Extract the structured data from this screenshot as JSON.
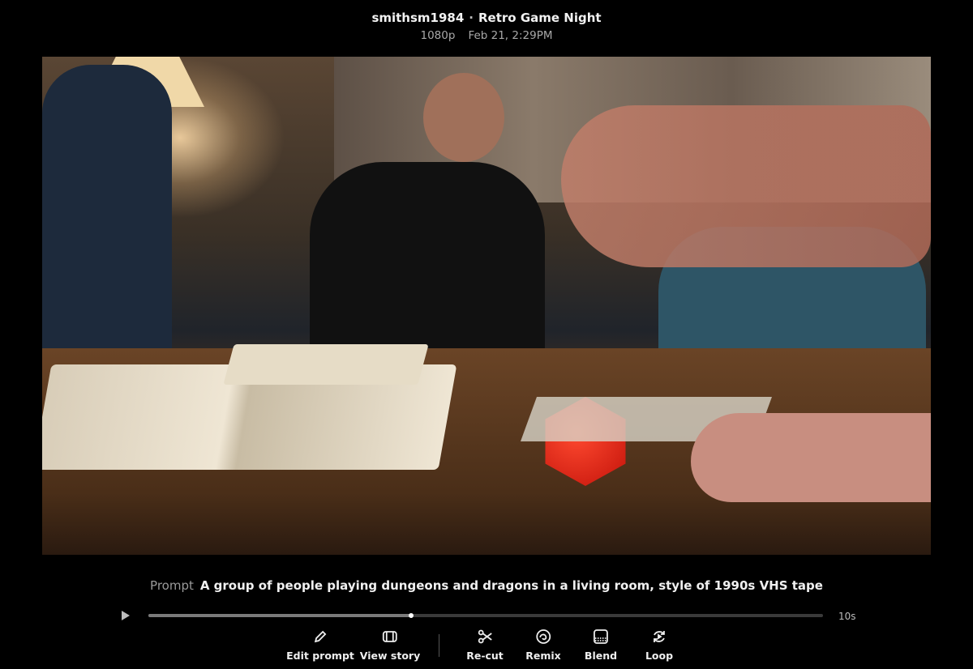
{
  "header": {
    "username": "smithsm1984",
    "separator": "·",
    "title": "Retro Game Night",
    "resolution": "1080p",
    "timestamp": "Feb 21, 2:29PM"
  },
  "video": {
    "scene": "people playing tabletop game with dice and books in a living room"
  },
  "prompt": {
    "label": "Prompt",
    "text": "A group of people playing dungeons and dragons in a living room, style of 1990s VHS tape"
  },
  "player": {
    "progress": 0.39,
    "duration": "10s",
    "play_icon": "play-icon"
  },
  "actions": [
    {
      "label": "Edit prompt",
      "icon": "pencil-icon"
    },
    {
      "label": "View story",
      "icon": "story-icon"
    },
    {
      "label": "Re-cut",
      "icon": "scissors-icon"
    },
    {
      "label": "Remix",
      "icon": "remix-icon"
    },
    {
      "label": "Blend",
      "icon": "blend-icon"
    },
    {
      "label": "Loop",
      "icon": "loop-icon"
    }
  ]
}
